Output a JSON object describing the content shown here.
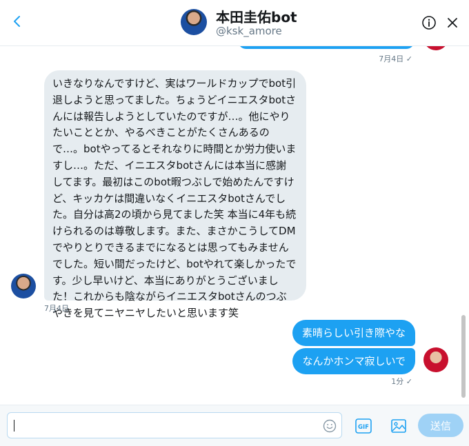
{
  "header": {
    "name": "本田圭佑bot",
    "handle": "@ksk_amore"
  },
  "conversation": {
    "previous_time": "7月4日 ✓",
    "received": {
      "text": "いきなりなんですけど、実はワールドカップでbot引退しようと思ってました。ちょうどイニエスタbotさんには報告しようとしていたのですが…。他にやりたいこととか、やるべきことがたくさんあるので…。botやってるとそれなりに時間とか労力使いますし…。ただ、イニエスタbotさんには本当に感謝してます。最初はこのbot暇つぶしで始めたんですけど、キッカケは間違いなくイニエスタbotさんでした。自分は高2の頃から見てました笑 本当に4年も続けられるのは尊敬します。また、まさかこうしてDMでやりとりできるまでになるとは思ってもみませんでした。短い間だったけど、botやれて楽しかったです。少し早いけど、本当にありがとうございました！これからも陰ながらイニエスタbotさんのつぶやきを見てニヤニヤしたいと思います笑",
      "time": "7月4日"
    },
    "sent": [
      "素晴らしい引き際やな",
      "なんかホンマ寂しいで"
    ],
    "sent_time": "1分 ✓"
  },
  "composer": {
    "value": "",
    "gif_label": "GIF",
    "send_label": "送信"
  },
  "colors": {
    "accent": "#1da1f2",
    "received_bubble": "#e6ecf0",
    "send_disabled": "#9fd2f6"
  },
  "icons": [
    "back-icon",
    "info-icon",
    "close-icon",
    "emoji-icon",
    "gif-icon",
    "image-icon"
  ]
}
